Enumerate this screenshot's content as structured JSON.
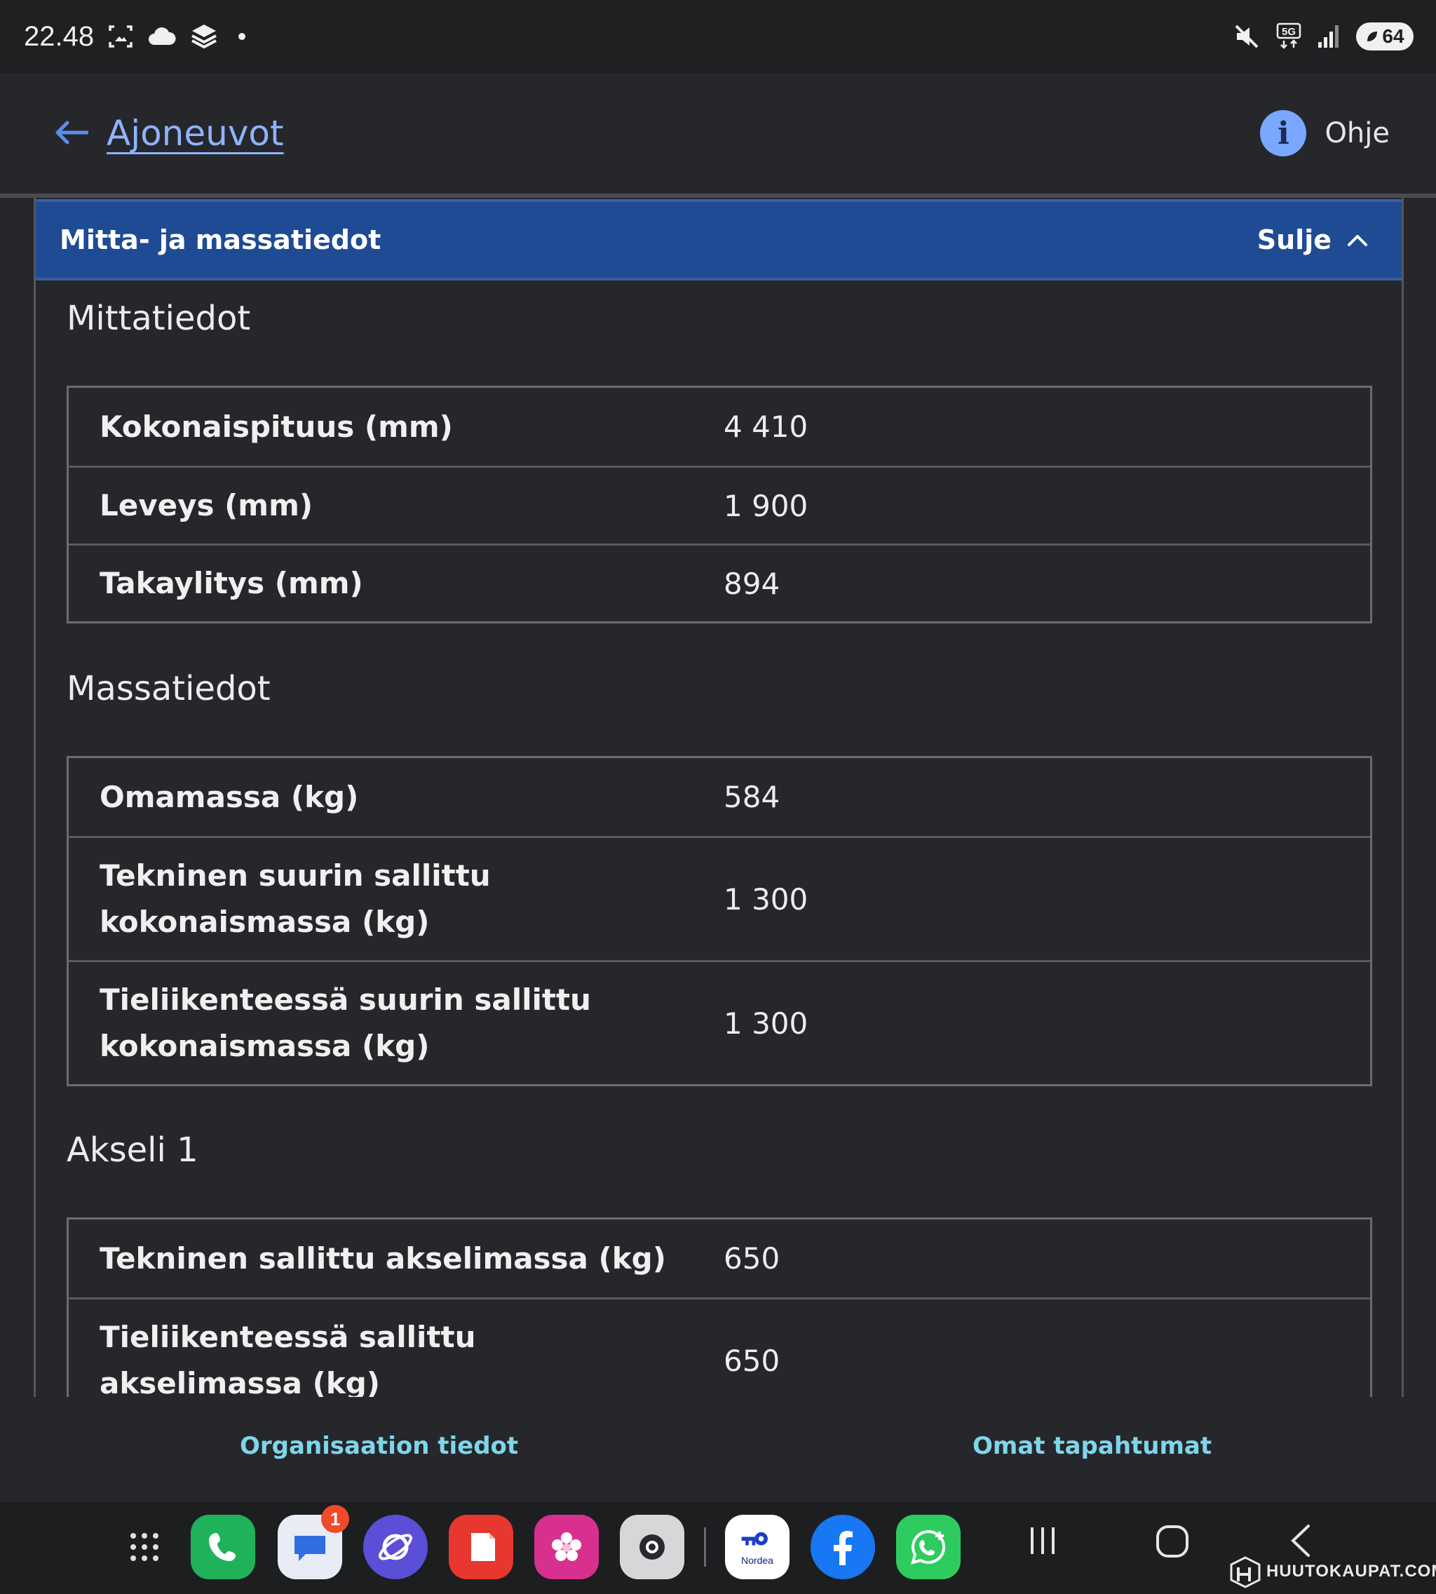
{
  "status_bar": {
    "time": "22.48",
    "battery": "64",
    "network": "5G",
    "icons": [
      "screenshot-icon",
      "cloud-icon",
      "layers-icon",
      "mute-icon",
      "signal-icon",
      "battery-icon"
    ]
  },
  "header": {
    "back_label": "Ajoneuvot",
    "help_label": "Ohje",
    "help_icon_glyph": "i"
  },
  "accordion": {
    "title": "Mitta- ja massatiedot",
    "toggle_label": "Sulje"
  },
  "sections": {
    "mitta": {
      "title": "Mittatiedot",
      "rows": [
        {
          "label": "Kokonaispituus (mm)",
          "value": "4 410"
        },
        {
          "label": "Leveys (mm)",
          "value": "1 900"
        },
        {
          "label": "Takaylitys (mm)",
          "value": "894"
        }
      ]
    },
    "massa": {
      "title": "Massatiedot",
      "rows": [
        {
          "label": "Omamassa (kg)",
          "value": "584"
        },
        {
          "label": "Tekninen suurin sallittu kokonaismassa (kg)",
          "value": "1 300"
        },
        {
          "label": "Tieliikenteessä suurin sallittu kokonaismassa (kg)",
          "value": "1 300"
        }
      ]
    },
    "akseli": {
      "title": "Akseli 1",
      "rows": [
        {
          "label": "Tekninen sallittu akselimassa (kg)",
          "value": "650"
        },
        {
          "label": "Tieliikenteessä sallittu akselimassa (kg)",
          "value": "650"
        }
      ]
    }
  },
  "bottom_links": {
    "left": "Organisaation tiedot",
    "right": "Omat tapahtumat"
  },
  "dock": {
    "messages_badge": "1",
    "nordea_label": "Nordea"
  },
  "watermark": {
    "text": "HUUTOKAUPAT.COM"
  },
  "colors": {
    "accent_blue": "#1f4b94",
    "link_blue": "#8fb3ff",
    "bottom_link": "#7ed6ea",
    "background": "#26272b"
  }
}
